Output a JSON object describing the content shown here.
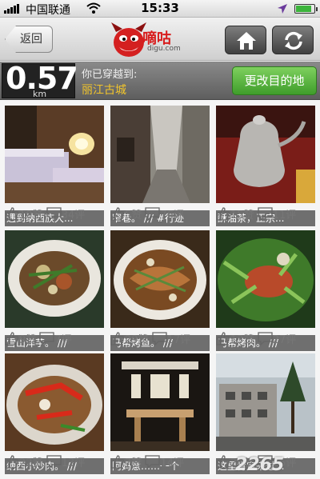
{
  "status_bar": {
    "carrier": "中国联通",
    "time": "15:33"
  },
  "nav": {
    "back_label": "返回",
    "logo_text": "嘀咕",
    "logo_subtext": "digu.com",
    "home_icon": "home-icon",
    "refresh_icon": "refresh-icon"
  },
  "travel": {
    "distance": "0.57",
    "unit": "km",
    "crossed_label": "你已穿越到:",
    "destination": "丽江古城",
    "change_button": "更改目的地"
  },
  "colors": {
    "accent_green": "#4fb03a",
    "destination_gold": "#f2c52b"
  },
  "posts": [
    {
      "caption": "遇到纳西族大...",
      "likes": "10赞",
      "comments": "34评"
    },
    {
      "caption": "窄巷。 ///  #行迹",
      "likes": "5赞",
      "comments": "76评"
    },
    {
      "caption": "酥油茶，正宗...",
      "likes": "15赞",
      "comments": "11评"
    },
    {
      "caption": "雪山洋芋。 ///",
      "likes": "9赞",
      "comments": "7评"
    },
    {
      "caption": "马帮烤鱼。 ///",
      "likes": "29赞",
      "comments": "17评"
    },
    {
      "caption": "马帮烤肉。 ///",
      "likes": "13赞",
      "comments": "27评"
    },
    {
      "caption": "纳西小炒肉。 ///",
      "likes": "22赞",
      "comments": "13评"
    },
    {
      "caption": "阿妈意……一个",
      "likes": "7赞",
      "comments": "14评"
    },
    {
      "caption": "这里肯定来过...",
      "likes": "20赞",
      "comments": "25评"
    }
  ],
  "watermark": "2265"
}
